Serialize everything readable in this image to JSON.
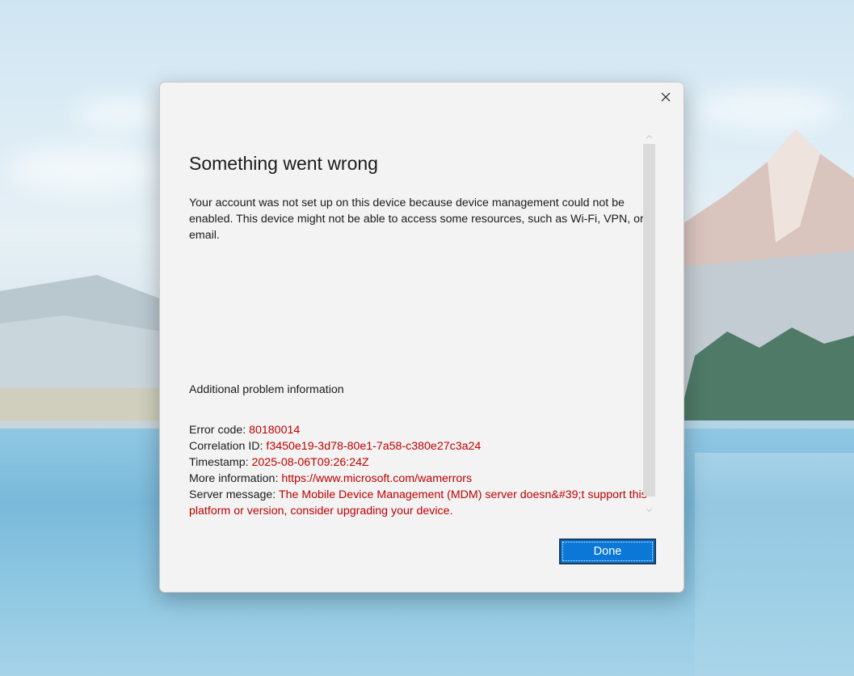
{
  "dialog": {
    "title": "Something went wrong",
    "message": "Your account was not set up on this device because device management could not be enabled. This device might not be able to access some resources, such as Wi-Fi, VPN, or email.",
    "info_heading": "Additional problem information",
    "info": {
      "error_code_label": "Error code: ",
      "error_code": "80180014",
      "correlation_label": "Correlation ID: ",
      "correlation_id": "f3450e19-3d78-80e1-7a58-c380e27c3a24",
      "timestamp_label": "Timestamp: ",
      "timestamp": "2025-08-06T09:26:24Z",
      "more_info_label": "More information: ",
      "more_info_url": "https://www.microsoft.com/wamerrors",
      "server_message_label": "Server message: ",
      "server_message": "The Mobile Device Management (MDM) server doesn&#39;t support this platform or version, consider upgrading your device."
    },
    "done_label": "Done"
  },
  "icons": {
    "close": "close-icon",
    "scroll_up": "chevron-up-icon",
    "scroll_down": "chevron-down-icon"
  },
  "colors": {
    "error_text": "#c00000",
    "primary_button": "#0b78d7",
    "dialog_background": "#f3f3f3"
  }
}
